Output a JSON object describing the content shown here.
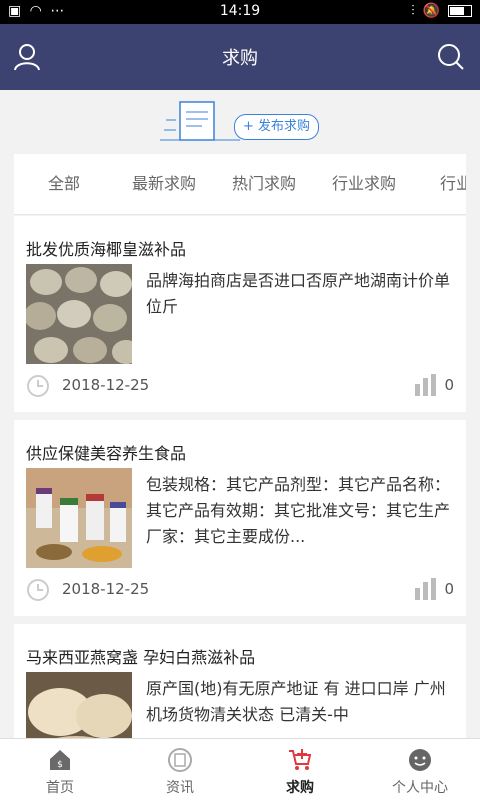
{
  "status_bar": {
    "time": "14:19"
  },
  "header": {
    "title": "求购"
  },
  "banner": {
    "publish_label": "+ 发布求购"
  },
  "tabs": [
    "全部",
    "最新求购",
    "热门求购",
    "行业求购",
    "行业分"
  ],
  "items": [
    {
      "title": "批发优质海椰皇滋补品",
      "desc": "品牌海拍商店是否进口否原产地湖南计价单位斤",
      "date": "2018-12-25",
      "views": "0",
      "image": "coconut-thumbnail"
    },
    {
      "title": "供应保健美容养生食品",
      "desc": "包装规格：其它产品剂型：其它产品名称：其它产品有效期：其它批准文号：其它生产厂家：其它主要成份...",
      "date": "2018-12-25",
      "views": "0",
      "image": "supplements-thumbnail"
    },
    {
      "title": "马来西亚燕窝盏 孕妇白燕滋补品",
      "desc": "原产国(地)有无原产地证 有 进口口岸 广州机场货物清关状态 已清关-中",
      "date": "",
      "views": "",
      "image": "birdnest-thumbnail"
    }
  ],
  "bottom_nav": [
    {
      "label": "首页",
      "icon": "home-icon"
    },
    {
      "label": "资讯",
      "icon": "news-icon"
    },
    {
      "label": "求购",
      "icon": "cart-icon"
    },
    {
      "label": "个人中心",
      "icon": "profile-icon"
    }
  ],
  "colors": {
    "header_bg": "#3c4370",
    "accent": "#3b82d9",
    "active_nav": "#e0383e"
  }
}
